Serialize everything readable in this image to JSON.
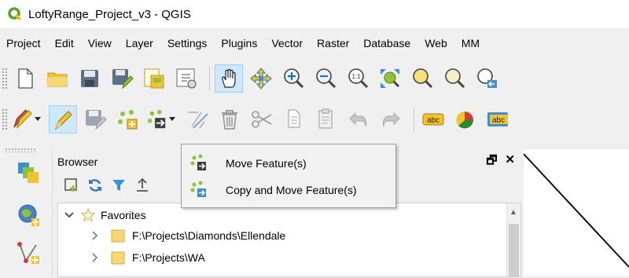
{
  "window": {
    "title": "LoftyRange_Project_v3 - QGIS"
  },
  "menu": [
    "Project",
    "Edit",
    "View",
    "Layer",
    "Settings",
    "Plugins",
    "Vector",
    "Raster",
    "Database",
    "Web",
    "MM"
  ],
  "label_tool": {
    "text": "abc"
  },
  "browser": {
    "title": "Browser",
    "float_label": "🗗",
    "close_label": "✕",
    "tree": [
      {
        "label": "Favorites",
        "expanded": true
      },
      {
        "label": "F:\\Projects\\Diamonds\\Ellendale",
        "expanded": false
      },
      {
        "label": "F:\\Projects\\WA",
        "expanded": false
      }
    ]
  },
  "move_menu": {
    "items": [
      {
        "label": "Move Feature(s)"
      },
      {
        "label": "Copy and Move Feature(s)"
      }
    ]
  },
  "colors": {
    "accent": "#cde8ff",
    "folder": "#f7d774",
    "qgis_green": "#5aa02c"
  }
}
